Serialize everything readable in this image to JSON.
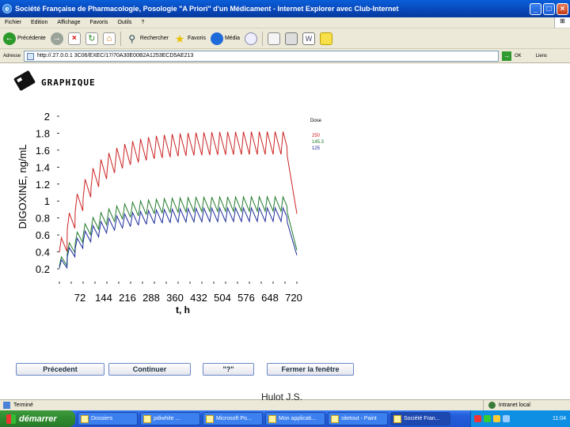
{
  "window": {
    "title": "Société Française de Pharmacologie, Posologie \"A Priori\" d'un Médicament - Internet Explorer avec Club-Internet"
  },
  "menu": [
    "Fichier",
    "Edition",
    "Affichage",
    "Favoris",
    "Outils",
    "?"
  ],
  "toolbar": {
    "back_label": "Précédente",
    "search_label": "Rechercher",
    "favorites_label": "Favoris",
    "media_label": "Média"
  },
  "address": {
    "label": "Adresse",
    "url": "http://.27.0.0.1 3C06/EXEC/17/70A30E00B2A1253ECD5AE213",
    "go_label": "OK",
    "links_label": "Liens"
  },
  "page": {
    "heading": "GRAPHIQUE"
  },
  "chart_data": {
    "type": "line",
    "xlabel": "t, h",
    "ylabel": "DIGOXINE, ng/mL",
    "x_ticks": [
      72,
      144,
      216,
      288,
      360,
      432,
      504,
      576,
      648,
      720
    ],
    "y_ticks": [
      "2",
      "1.8",
      "1.6",
      "1.4",
      "1.2",
      "1",
      "0.8",
      "0.6",
      "0.4",
      "0.2"
    ],
    "xlim": [
      0,
      720
    ],
    "ylim": [
      0.1,
      2.0
    ],
    "legend_title": "Dose",
    "legend_position": "top-right",
    "dosing_interval_h": 24,
    "infusion_end_h": 690,
    "series": [
      {
        "name": "250",
        "color": "#cc2222",
        "trough_start": 0.3,
        "steady_trough": 1.55,
        "steady_peak": 1.82,
        "end_value": 0.85
      },
      {
        "name": "145.3",
        "color": "#1f7a2a",
        "trough_start": 0.18,
        "steady_trough": 0.88,
        "steady_peak": 1.05,
        "end_value": 0.42
      },
      {
        "name": "125",
        "color": "#1a2a9a",
        "trough_start": 0.16,
        "steady_trough": 0.76,
        "steady_peak": 0.92,
        "end_value": 0.36
      }
    ]
  },
  "buttons": {
    "prev": "Précedent",
    "next": "Continuer",
    "help": "\"?\"",
    "close": "Fermer la fenêtre"
  },
  "status": {
    "text": "Terminé",
    "zone": "Intranet local"
  },
  "watermark": "Hulot J.S.",
  "taskbar": {
    "start": "démarrer",
    "tasks": [
      "Dossiers",
      "pdiwhite ...",
      "Microsoft Po...",
      "Mon applicati...",
      "sitetout - Paint",
      "Société Fran..."
    ],
    "clock": "11:04"
  }
}
